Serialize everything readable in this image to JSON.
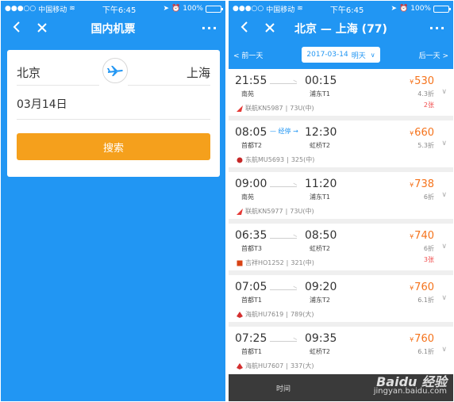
{
  "status": {
    "carrier": "中国移动",
    "time": "下午6:45",
    "battery": "100%"
  },
  "left": {
    "title": "国内机票",
    "from_city": "北京",
    "to_city": "上海",
    "date": "03月14日",
    "search_label": "搜索"
  },
  "right": {
    "title": "北京 — 上海 (77)",
    "prev_day": "< 前一天",
    "next_day": "后一天 >",
    "date": "2017-03-14",
    "day_label": "明天",
    "flights": [
      {
        "dep_time": "21:55",
        "dep_airport": "南苑",
        "arr_time": "00:15",
        "arr_airport": "浦东T1",
        "stop": "",
        "airline": "联航KN5987",
        "aircraft": "73U(中)",
        "price": "530",
        "discount": "4.3折",
        "tickets": "2张",
        "logo_color": "#e53935"
      },
      {
        "dep_time": "08:05",
        "dep_airport": "首都T2",
        "arr_time": "12:30",
        "arr_airport": "虹桥T2",
        "stop": "经停",
        "airline": "东航MU5693",
        "aircraft": "325(中)",
        "price": "660",
        "discount": "5.3折",
        "tickets": "",
        "logo_color": "#c62828"
      },
      {
        "dep_time": "09:00",
        "dep_airport": "南苑",
        "arr_time": "11:20",
        "arr_airport": "浦东T1",
        "stop": "",
        "airline": "联航KN5977",
        "aircraft": "73U(中)",
        "price": "738",
        "discount": "6折",
        "tickets": "",
        "logo_color": "#e53935"
      },
      {
        "dep_time": "06:35",
        "dep_airport": "首都T3",
        "arr_time": "08:50",
        "arr_airport": "虹桥T2",
        "stop": "",
        "airline": "吉祥HO1252",
        "aircraft": "321(中)",
        "price": "740",
        "discount": "6折",
        "tickets": "3张",
        "logo_color": "#d84315"
      },
      {
        "dep_time": "07:05",
        "dep_airport": "首都T1",
        "arr_time": "09:20",
        "arr_airport": "浦东T2",
        "stop": "",
        "airline": "海航HU7619",
        "aircraft": "789(大)",
        "price": "760",
        "discount": "6.1折",
        "tickets": "",
        "logo_color": "#d32f2f"
      },
      {
        "dep_time": "07:25",
        "dep_airport": "首都T1",
        "arr_time": "09:35",
        "arr_airport": "虹桥T2",
        "stop": "",
        "airline": "海航HU7607",
        "aircraft": "337(大)",
        "price": "760",
        "discount": "6.1折",
        "tickets": "",
        "logo_color": "#d32f2f"
      }
    ],
    "bottom_tab": "时间"
  },
  "watermark": {
    "logo": "Baidu 经验",
    "url": "jingyan.baidu.com"
  }
}
